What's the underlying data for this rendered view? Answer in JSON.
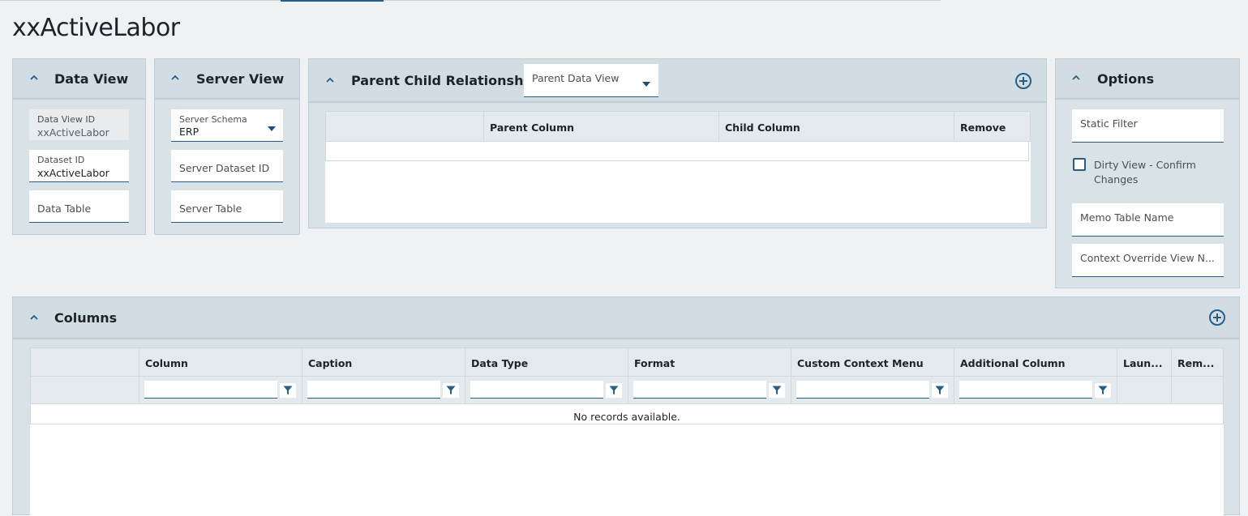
{
  "page": {
    "title": "xxActiveLabor"
  },
  "data_view": {
    "title": "Data View",
    "dataview_id": {
      "label": "Data View ID",
      "value": "xxActiveLabor"
    },
    "dataset_id": {
      "label": "Dataset ID",
      "value": "xxActiveLabor"
    },
    "data_table": {
      "placeholder": "Data Table"
    }
  },
  "server_view": {
    "title": "Server View",
    "server_schema": {
      "label": "Server Schema",
      "value": "ERP"
    },
    "server_dataset_id": {
      "placeholder": "Server Dataset ID"
    },
    "server_table": {
      "placeholder": "Server Table"
    }
  },
  "parent_child": {
    "title": "Parent Child Relationships",
    "parent_data_view": {
      "placeholder": "Parent Data View"
    },
    "columns": [
      "",
      "Parent Column",
      "Child Column",
      "Remove"
    ]
  },
  "options": {
    "title": "Options",
    "static_filter": {
      "placeholder": "Static Filter"
    },
    "dirty_view": {
      "label_line1": "Dirty View - Confirm",
      "label_line2": "Changes",
      "checked": false
    },
    "memo_table_name": {
      "placeholder": "Memo Table Name"
    },
    "context_override": {
      "placeholder": "Context Override View N..."
    }
  },
  "columns_panel": {
    "title": "Columns",
    "headers": [
      "",
      "Column",
      "Caption",
      "Data Type",
      "Format",
      "Custom Context Menu",
      "Additional Column",
      "Laun...",
      "Rem..."
    ],
    "empty_message": "No records available."
  },
  "colors": {
    "accent": "#2a5d86",
    "panel_bg": "#d9e2e7",
    "header_bg": "#d2dde3"
  },
  "icons": {
    "collapse": "chevron-up-icon",
    "add": "plus-circle-icon",
    "filter": "filter-icon",
    "dropdown": "caret-down-icon"
  }
}
